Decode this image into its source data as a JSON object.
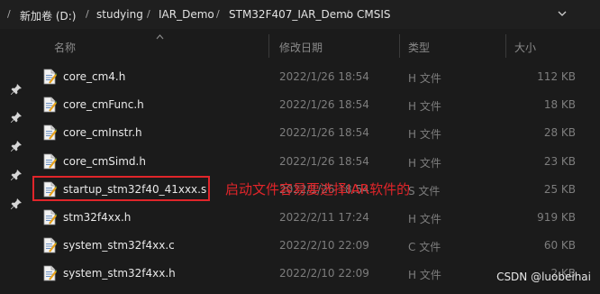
{
  "address_bar": {
    "segments": [
      "新加卷 (D:)",
      "studying",
      "IAR_Demo",
      "STM32F407_IAR_Demo",
      "CMSIS"
    ]
  },
  "columns": {
    "name": "名称",
    "modified": "修改日期",
    "type": "类型",
    "size": "大小"
  },
  "files": [
    {
      "name": "core_cm4.h",
      "modified": "2022/1/26 18:54",
      "type": "H 文件",
      "size": "112 KB"
    },
    {
      "name": "core_cmFunc.h",
      "modified": "2022/1/26 18:54",
      "type": "H 文件",
      "size": "18 KB"
    },
    {
      "name": "core_cmInstr.h",
      "modified": "2022/1/26 18:54",
      "type": "H 文件",
      "size": "28 KB"
    },
    {
      "name": "core_cmSimd.h",
      "modified": "2022/1/26 18:54",
      "type": "H 文件",
      "size": "23 KB"
    },
    {
      "name": "startup_stm32f40_41xxx.s",
      "modified": "2022/1/26 18:54",
      "type": "S 文件",
      "size": "25 KB"
    },
    {
      "name": "stm32f4xx.h",
      "modified": "2022/2/11 17:24",
      "type": "H 文件",
      "size": "919 KB"
    },
    {
      "name": "system_stm32f4xx.c",
      "modified": "2022/2/10 22:09",
      "type": "C 文件",
      "size": "60 KB"
    },
    {
      "name": "system_stm32f4xx.h",
      "modified": "2022/2/10 22:09",
      "type": "H 文件",
      "size": "2 KB"
    }
  ],
  "annotation": "启动文件容易要选择IAR软件的",
  "watermark": "CSDN @luobeihai",
  "icons": {
    "pin": "pin-icon",
    "file": "file-icon",
    "dropdown": "chevron-down-icon",
    "separator": "chevron-right-icon"
  }
}
